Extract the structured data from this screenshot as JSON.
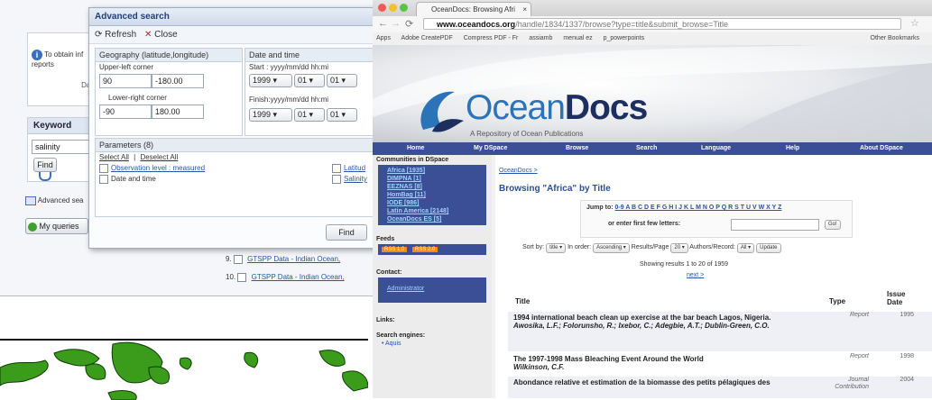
{
  "left_app": {
    "info_text": "To obtain inf",
    "info_text2": "reports",
    "bg_label_1": "Data",
    "bg_label_2": "Ba",
    "keyword_header": "Keyword",
    "keyword_value": "salinity",
    "find_small": "Find",
    "advanced_search_link": "Advanced sea",
    "my_queries": "My queries",
    "adv": {
      "title": "Advanced search",
      "refresh": "Refresh",
      "close": "Close",
      "geo_header": "Geography (latitude,longitude)",
      "upper_left": "Upper-left corner",
      "ul_lat": "90",
      "ul_lon": "-180.00",
      "lower_right": "Lower-right corner",
      "lr_lat": "-90",
      "lr_lon": "180.00",
      "dt_header": "Date and time",
      "start_label": "Start : yyyy/mm/dd hh:mi",
      "start_year": "1999",
      "start_month": "01",
      "start_day": "01",
      "finish_label": "Finish:yyyy/mm/dd hh:mi",
      "finish_year": "1999",
      "finish_month": "01",
      "finish_day": "01",
      "params_header": "Parameters (8)",
      "select_all": "Select All",
      "deselect_all": "Deselect All",
      "param_1": "Observation level : measured",
      "param_2": "Date and time",
      "param_3": "Latitud",
      "param_4": "Salinity",
      "find_button": "Find"
    },
    "results": [
      {
        "num": "9.",
        "text": "GTSPP Data - Indian Ocean,"
      },
      {
        "num": "10.",
        "text": "GTSPP Data - Indian Ocean,"
      }
    ]
  },
  "browser": {
    "tab_title": "OceanDocs: Browsing Afri",
    "url_host": "www.oceandocs.org",
    "url_path": "/handle/1834/1337/browse?type=title&submit_browse=Title",
    "bookmarks": [
      "Apps",
      "Adobe CreatePDF",
      "Compress PDF - Fr",
      "assiamb",
      "menual ez",
      "p_powerpoints",
      "Other Bookmarks"
    ],
    "logo_light": "Ocean",
    "logo_dark": "Docs",
    "tagline": "A Repository of Ocean Publications",
    "nav": [
      "Home",
      "My DSpace",
      "Browse",
      "Search",
      "Language",
      "Help",
      "About DSpace"
    ],
    "sidebar": {
      "communities_header": "Communities in DSpace",
      "communities": [
        "Africa [1935]",
        "DIMPNA [1]",
        "EEZNAS [8]",
        "HomBag [11]",
        "IODE [986]",
        "Latin America [2148]",
        "OceanDocs ES [5]"
      ],
      "feeds_header": "Feeds",
      "feed_1": "RSS 1.0",
      "feed_2": "RSS 2.0",
      "contact_header": "Contact:",
      "contact_link": "Administrator",
      "links_header": "Links:",
      "search_engines": "Search engines:",
      "search_engine_1": "Aquis"
    },
    "main": {
      "breadcrumb": "OceanDocs >",
      "heading": "Browsing \"Africa\" by Title",
      "jump_to": "Jump to:",
      "letters": "0-9 A B C D E F G H I J K L M N O P Q R S T U V W X Y Z",
      "first_letters": "or enter first few letters:",
      "go": "Go!",
      "sort_by": "Sort by:",
      "sort_value": "title",
      "in_order": "In order:",
      "order_value": "Ascending",
      "results_page": "Results/Page",
      "rpp_value": "20",
      "authors_record": "Authors/Record:",
      "authors_value": "All",
      "update": "Update",
      "showing": "Showing results 1 to 20 of 1959",
      "next": "next >",
      "col_title": "Title",
      "col_type": "Type",
      "col_date": "Issue Date",
      "rows": [
        {
          "title": "1994 international beach clean up exercise at the bar beach Lagos, Nigeria.",
          "authors": "Awosika, L.F.; Folorunsho, R.; Ixebor, C.; Adegbie, A.T.; Dublin-Green, C.O.",
          "type": "Report",
          "date": "1995"
        },
        {
          "title": "The 1997-1998 Mass Bleaching Event Around the World",
          "authors": "Wilkinson, C.F.",
          "type": "Report",
          "date": "1998"
        },
        {
          "title": "Abondance relative et estimation de la biomasse des petits pélagiques des",
          "authors": "",
          "type": "Journal Contribution",
          "date": "2004"
        }
      ]
    }
  },
  "colors": {
    "accent": "#3a4f96",
    "logo_blue": "#2b74b8",
    "land": "#3b9c1c"
  }
}
